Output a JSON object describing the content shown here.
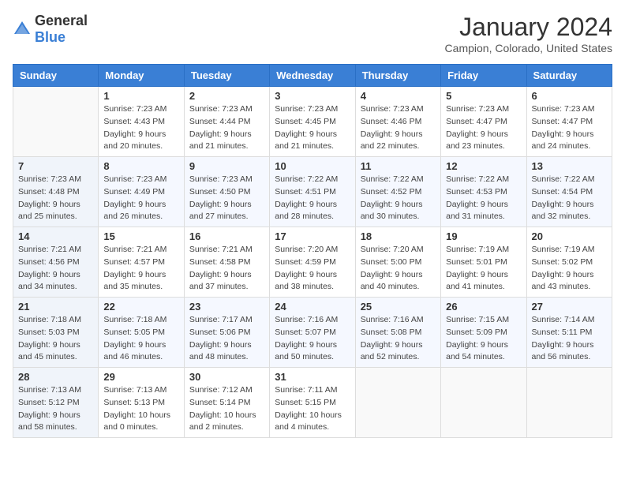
{
  "logo": {
    "general": "General",
    "blue": "Blue"
  },
  "header": {
    "month": "January 2024",
    "location": "Campion, Colorado, United States"
  },
  "days_of_week": [
    "Sunday",
    "Monday",
    "Tuesday",
    "Wednesday",
    "Thursday",
    "Friday",
    "Saturday"
  ],
  "weeks": [
    [
      {
        "day": "",
        "sunrise": "",
        "sunset": "",
        "daylight": ""
      },
      {
        "day": "1",
        "sunrise": "Sunrise: 7:23 AM",
        "sunset": "Sunset: 4:43 PM",
        "daylight": "Daylight: 9 hours and 20 minutes."
      },
      {
        "day": "2",
        "sunrise": "Sunrise: 7:23 AM",
        "sunset": "Sunset: 4:44 PM",
        "daylight": "Daylight: 9 hours and 21 minutes."
      },
      {
        "day": "3",
        "sunrise": "Sunrise: 7:23 AM",
        "sunset": "Sunset: 4:45 PM",
        "daylight": "Daylight: 9 hours and 21 minutes."
      },
      {
        "day": "4",
        "sunrise": "Sunrise: 7:23 AM",
        "sunset": "Sunset: 4:46 PM",
        "daylight": "Daylight: 9 hours and 22 minutes."
      },
      {
        "day": "5",
        "sunrise": "Sunrise: 7:23 AM",
        "sunset": "Sunset: 4:47 PM",
        "daylight": "Daylight: 9 hours and 23 minutes."
      },
      {
        "day": "6",
        "sunrise": "Sunrise: 7:23 AM",
        "sunset": "Sunset: 4:47 PM",
        "daylight": "Daylight: 9 hours and 24 minutes."
      }
    ],
    [
      {
        "day": "7",
        "sunrise": "Sunrise: 7:23 AM",
        "sunset": "Sunset: 4:48 PM",
        "daylight": "Daylight: 9 hours and 25 minutes."
      },
      {
        "day": "8",
        "sunrise": "Sunrise: 7:23 AM",
        "sunset": "Sunset: 4:49 PM",
        "daylight": "Daylight: 9 hours and 26 minutes."
      },
      {
        "day": "9",
        "sunrise": "Sunrise: 7:23 AM",
        "sunset": "Sunset: 4:50 PM",
        "daylight": "Daylight: 9 hours and 27 minutes."
      },
      {
        "day": "10",
        "sunrise": "Sunrise: 7:22 AM",
        "sunset": "Sunset: 4:51 PM",
        "daylight": "Daylight: 9 hours and 28 minutes."
      },
      {
        "day": "11",
        "sunrise": "Sunrise: 7:22 AM",
        "sunset": "Sunset: 4:52 PM",
        "daylight": "Daylight: 9 hours and 30 minutes."
      },
      {
        "day": "12",
        "sunrise": "Sunrise: 7:22 AM",
        "sunset": "Sunset: 4:53 PM",
        "daylight": "Daylight: 9 hours and 31 minutes."
      },
      {
        "day": "13",
        "sunrise": "Sunrise: 7:22 AM",
        "sunset": "Sunset: 4:54 PM",
        "daylight": "Daylight: 9 hours and 32 minutes."
      }
    ],
    [
      {
        "day": "14",
        "sunrise": "Sunrise: 7:21 AM",
        "sunset": "Sunset: 4:56 PM",
        "daylight": "Daylight: 9 hours and 34 minutes."
      },
      {
        "day": "15",
        "sunrise": "Sunrise: 7:21 AM",
        "sunset": "Sunset: 4:57 PM",
        "daylight": "Daylight: 9 hours and 35 minutes."
      },
      {
        "day": "16",
        "sunrise": "Sunrise: 7:21 AM",
        "sunset": "Sunset: 4:58 PM",
        "daylight": "Daylight: 9 hours and 37 minutes."
      },
      {
        "day": "17",
        "sunrise": "Sunrise: 7:20 AM",
        "sunset": "Sunset: 4:59 PM",
        "daylight": "Daylight: 9 hours and 38 minutes."
      },
      {
        "day": "18",
        "sunrise": "Sunrise: 7:20 AM",
        "sunset": "Sunset: 5:00 PM",
        "daylight": "Daylight: 9 hours and 40 minutes."
      },
      {
        "day": "19",
        "sunrise": "Sunrise: 7:19 AM",
        "sunset": "Sunset: 5:01 PM",
        "daylight": "Daylight: 9 hours and 41 minutes."
      },
      {
        "day": "20",
        "sunrise": "Sunrise: 7:19 AM",
        "sunset": "Sunset: 5:02 PM",
        "daylight": "Daylight: 9 hours and 43 minutes."
      }
    ],
    [
      {
        "day": "21",
        "sunrise": "Sunrise: 7:18 AM",
        "sunset": "Sunset: 5:03 PM",
        "daylight": "Daylight: 9 hours and 45 minutes."
      },
      {
        "day": "22",
        "sunrise": "Sunrise: 7:18 AM",
        "sunset": "Sunset: 5:05 PM",
        "daylight": "Daylight: 9 hours and 46 minutes."
      },
      {
        "day": "23",
        "sunrise": "Sunrise: 7:17 AM",
        "sunset": "Sunset: 5:06 PM",
        "daylight": "Daylight: 9 hours and 48 minutes."
      },
      {
        "day": "24",
        "sunrise": "Sunrise: 7:16 AM",
        "sunset": "Sunset: 5:07 PM",
        "daylight": "Daylight: 9 hours and 50 minutes."
      },
      {
        "day": "25",
        "sunrise": "Sunrise: 7:16 AM",
        "sunset": "Sunset: 5:08 PM",
        "daylight": "Daylight: 9 hours and 52 minutes."
      },
      {
        "day": "26",
        "sunrise": "Sunrise: 7:15 AM",
        "sunset": "Sunset: 5:09 PM",
        "daylight": "Daylight: 9 hours and 54 minutes."
      },
      {
        "day": "27",
        "sunrise": "Sunrise: 7:14 AM",
        "sunset": "Sunset: 5:11 PM",
        "daylight": "Daylight: 9 hours and 56 minutes."
      }
    ],
    [
      {
        "day": "28",
        "sunrise": "Sunrise: 7:13 AM",
        "sunset": "Sunset: 5:12 PM",
        "daylight": "Daylight: 9 hours and 58 minutes."
      },
      {
        "day": "29",
        "sunrise": "Sunrise: 7:13 AM",
        "sunset": "Sunset: 5:13 PM",
        "daylight": "Daylight: 10 hours and 0 minutes."
      },
      {
        "day": "30",
        "sunrise": "Sunrise: 7:12 AM",
        "sunset": "Sunset: 5:14 PM",
        "daylight": "Daylight: 10 hours and 2 minutes."
      },
      {
        "day": "31",
        "sunrise": "Sunrise: 7:11 AM",
        "sunset": "Sunset: 5:15 PM",
        "daylight": "Daylight: 10 hours and 4 minutes."
      },
      {
        "day": "",
        "sunrise": "",
        "sunset": "",
        "daylight": ""
      },
      {
        "day": "",
        "sunrise": "",
        "sunset": "",
        "daylight": ""
      },
      {
        "day": "",
        "sunrise": "",
        "sunset": "",
        "daylight": ""
      }
    ]
  ]
}
